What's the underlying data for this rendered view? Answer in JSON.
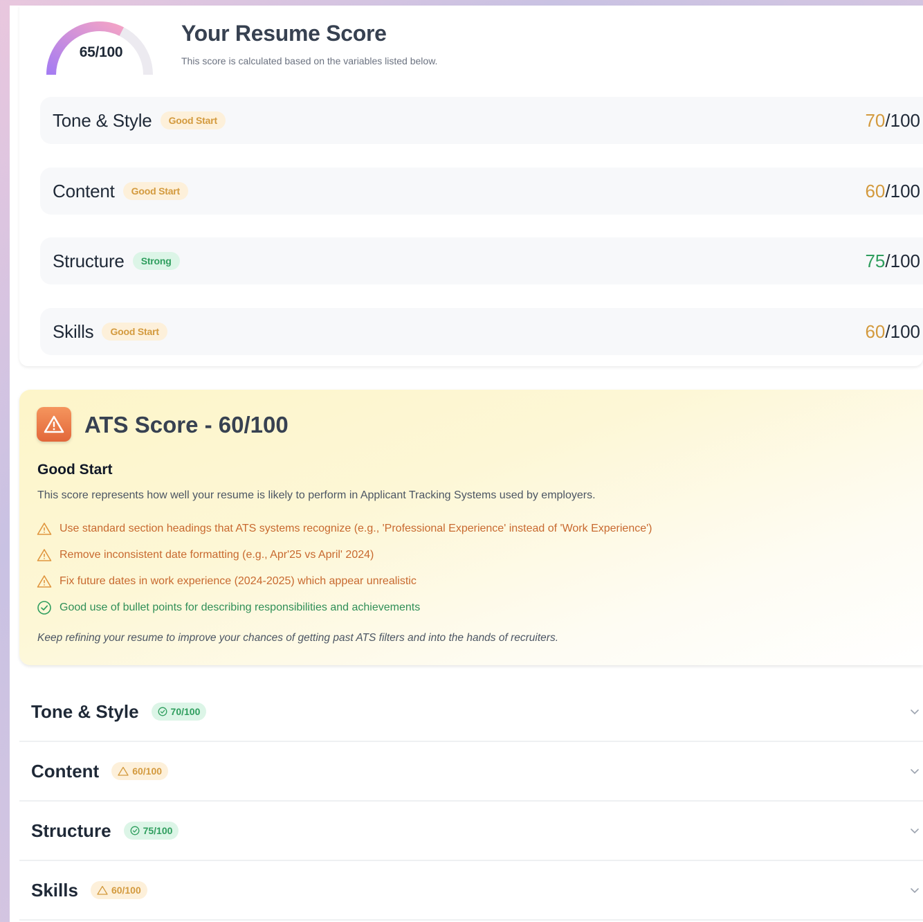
{
  "summary": {
    "overall_score": "65/100",
    "overall_fraction": 0.65,
    "title": "Your Resume Score",
    "subtitle": "This score is calculated based on the variables listed below.",
    "categories": [
      {
        "name": "Tone & Style",
        "status": "Good Start",
        "score": "70",
        "out_of": "/100"
      },
      {
        "name": "Content",
        "status": "Good Start",
        "score": "60",
        "out_of": "/100"
      },
      {
        "name": "Structure",
        "status": "Strong",
        "score": "75",
        "out_of": "/100"
      },
      {
        "name": "Skills",
        "status": "Good Start",
        "score": "60",
        "out_of": "/100"
      }
    ]
  },
  "ats": {
    "title": "ATS Score - 60/100",
    "subtitle": "Good Start",
    "description": "This score represents how well your resume is likely to perform in Applicant Tracking Systems used by employers.",
    "tips": [
      {
        "type": "warning",
        "icon": "warning-icon",
        "text": "Use standard section headings that ATS systems recognize (e.g., 'Professional Experience' instead of 'Work Experience')"
      },
      {
        "type": "warning",
        "icon": "warning-icon",
        "text": "Remove inconsistent date formatting (e.g., Apr'25 vs April' 2024)"
      },
      {
        "type": "warning",
        "icon": "warning-icon",
        "text": "Fix future dates in work experience (2024-2025) which appear unrealistic"
      },
      {
        "type": "good",
        "icon": "check-circle-icon",
        "text": "Good use of bullet points for describing responsibilities and achievements"
      }
    ],
    "footer": "Keep refining your resume to improve your chances of getting past ATS filters and into the hands of recruiters."
  },
  "accordion": [
    {
      "name": "Tone & Style",
      "badge": "70/100",
      "type": "good"
    },
    {
      "name": "Content",
      "badge": "60/100",
      "type": "warning"
    },
    {
      "name": "Structure",
      "badge": "75/100",
      "type": "good"
    },
    {
      "name": "Skills",
      "badge": "60/100",
      "type": "warning"
    }
  ],
  "colors": {
    "warning": "#d39a3e",
    "good": "#2f9e5e",
    "ats_icon": "#e9723f",
    "gauge_start": "#a57cf2",
    "gauge_end": "#f3a3c6"
  }
}
